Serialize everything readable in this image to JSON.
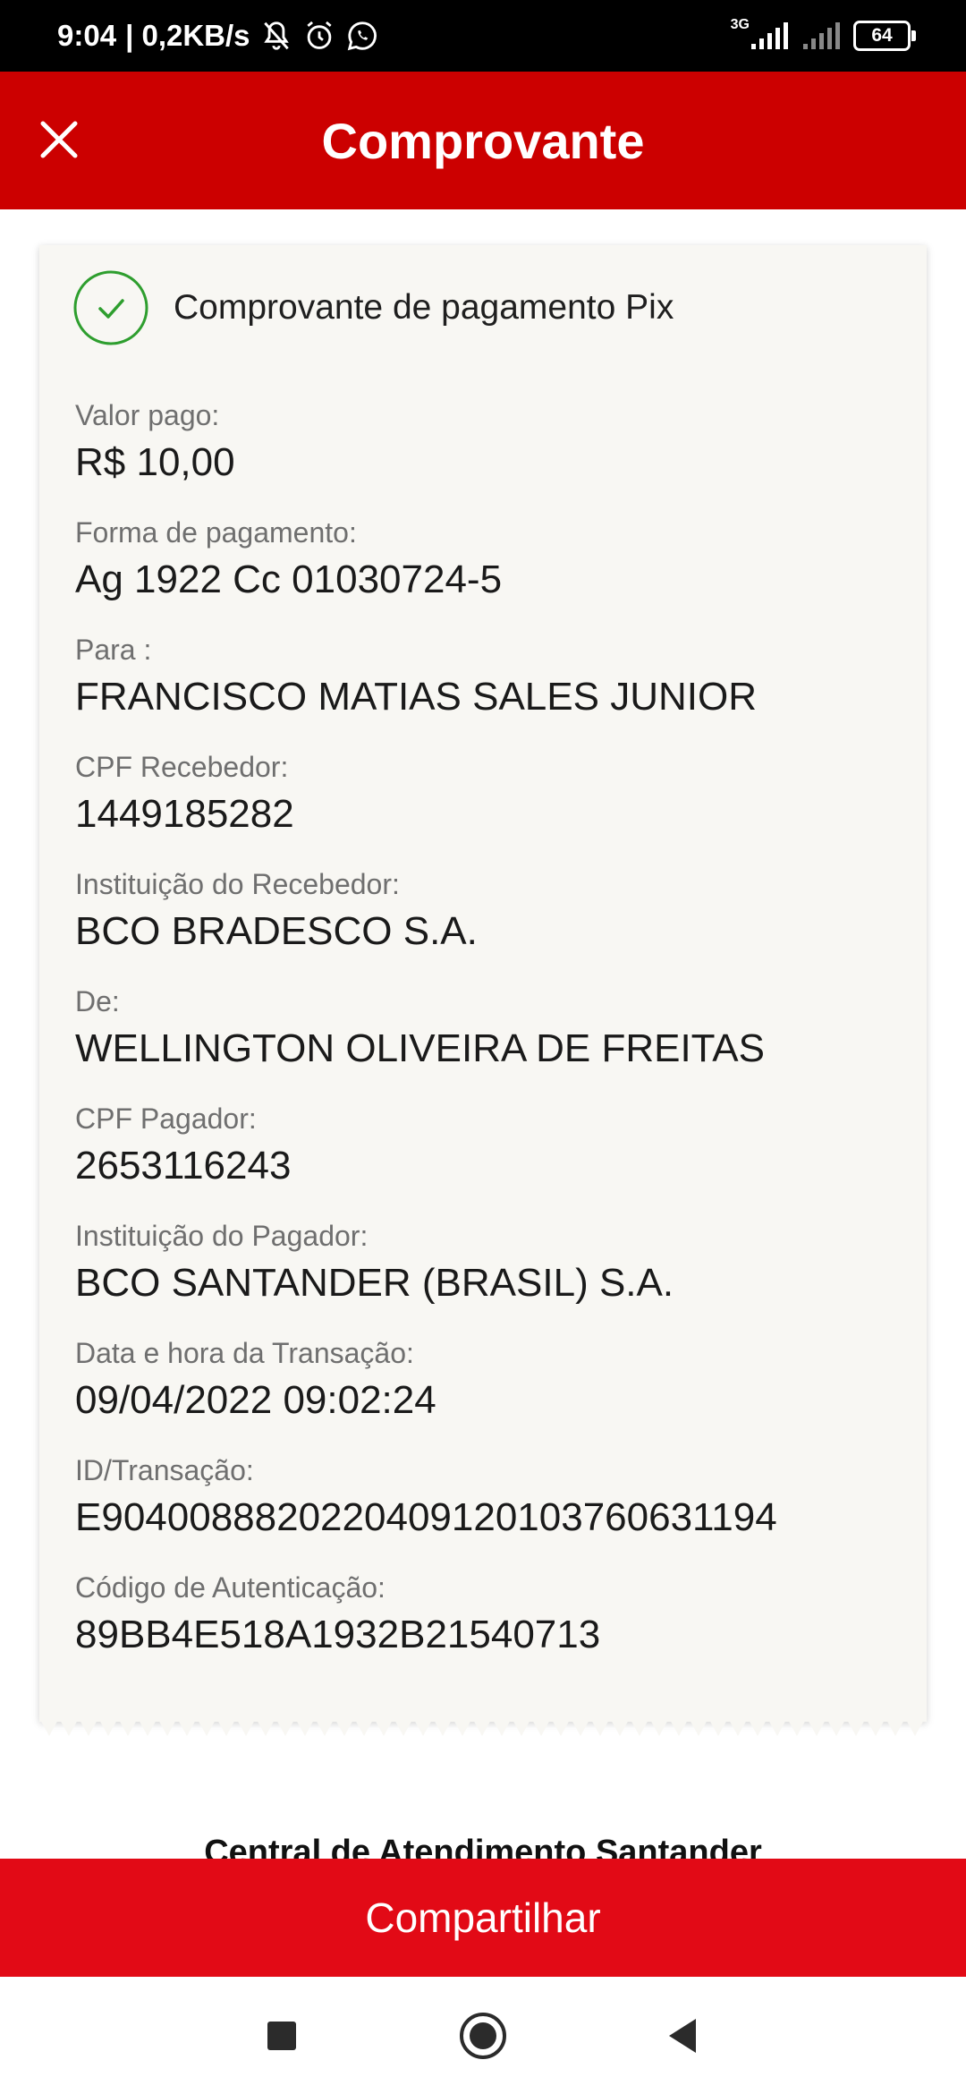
{
  "status_bar": {
    "time": "9:04",
    "speed": "| 0,2KB/s",
    "network": "3G",
    "battery": "64"
  },
  "header": {
    "title": "Comprovante"
  },
  "receipt": {
    "title": "Comprovante de pagamento Pix",
    "fields": [
      {
        "label": "Valor pago:",
        "value": "R$ 10,00"
      },
      {
        "label": "Forma de pagamento:",
        "value": "Ag 1922 Cc 01030724-5"
      },
      {
        "label": "Para :",
        "value": "FRANCISCO MATIAS SALES JUNIOR"
      },
      {
        "label": "CPF Recebedor:",
        "value": "1449185282"
      },
      {
        "label": "Instituição do Recebedor:",
        "value": "BCO BRADESCO S.A."
      },
      {
        "label": "De:",
        "value": "WELLINGTON OLIVEIRA DE FREITAS"
      },
      {
        "label": "CPF Pagador:",
        "value": "2653116243"
      },
      {
        "label": "Instituição do Pagador:",
        "value": "BCO SANTANDER (BRASIL) S.A."
      },
      {
        "label": "Data e hora da Transação:",
        "value": "09/04/2022 09:02:24"
      },
      {
        "label": "ID/Transação:",
        "value": "E90400888202204091201037606311​94"
      },
      {
        "label": "Código de Autenticação:",
        "value": "89BB4E518A1932B21540713"
      }
    ]
  },
  "support": {
    "text": "Central de Atendimento Santander"
  },
  "actions": {
    "share_label": "Compartilhar"
  },
  "colors": {
    "header_red": "#cc0000",
    "button_red": "#e20a16",
    "check_green": "#2e9e2e"
  }
}
